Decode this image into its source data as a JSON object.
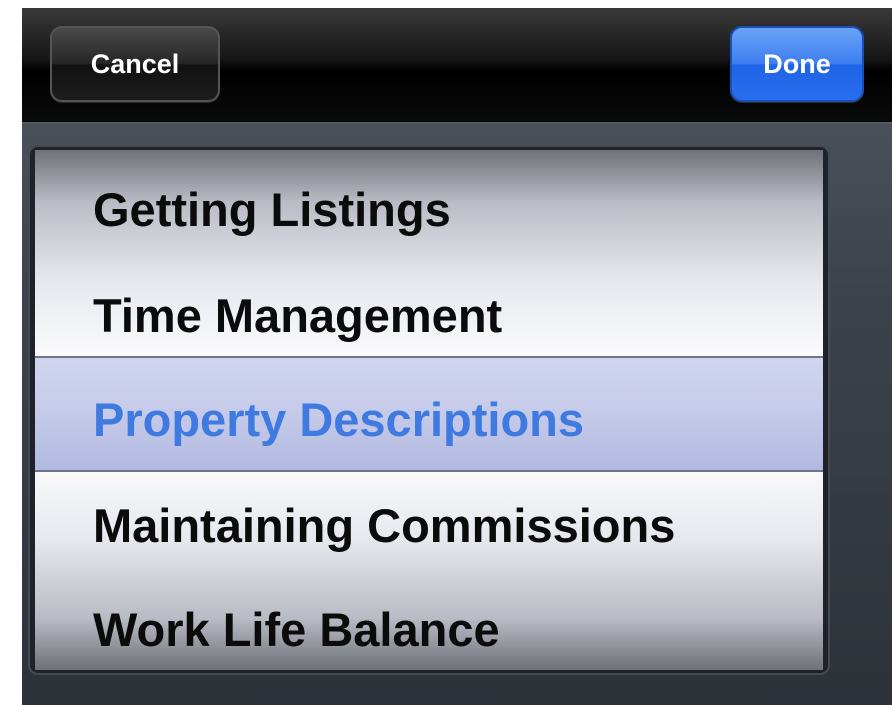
{
  "toolbar": {
    "cancel_label": "Cancel",
    "done_label": "Done"
  },
  "picker": {
    "items": [
      {
        "label": "Getting Listings"
      },
      {
        "label": "Time Management"
      },
      {
        "label": "Property Descriptions"
      },
      {
        "label": "Maintaining Commissions"
      },
      {
        "label": "Work Life Balance"
      }
    ],
    "selected_index": 2
  },
  "colors": {
    "done_button": "#2a6ef0",
    "selected_text": "#3e7ae0",
    "toolbar": "#000000"
  }
}
